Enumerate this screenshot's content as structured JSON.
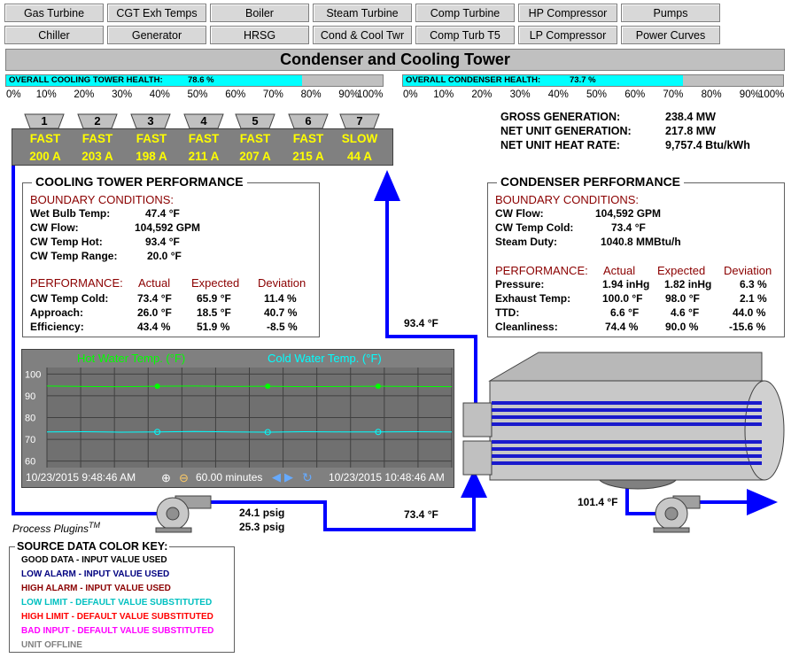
{
  "nav": {
    "row1": [
      "Gas Turbine",
      "CGT Exh Temps",
      "Boiler",
      "Steam Turbine",
      "Comp Turbine",
      "HP Compressor",
      "Pumps"
    ],
    "row2": [
      "Chiller",
      "Generator",
      "HRSG",
      "Cond & Cool Twr",
      "Comp Turb T5",
      "LP Compressor",
      "Power Curves"
    ]
  },
  "title": "Condenser and Cooling Tower",
  "health": {
    "cooling_label": "OVERALL COOLING TOWER HEALTH:",
    "cooling_value": "78.6 %",
    "cooling_fraction": 0.786,
    "condenser_label": "OVERALL CONDENSER HEALTH:",
    "condenser_value": "73.7 %",
    "condenser_fraction": 0.737,
    "ticks": [
      "0%",
      "10%",
      "20%",
      "30%",
      "40%",
      "50%",
      "60%",
      "70%",
      "80%",
      "90%",
      "100%"
    ]
  },
  "fans": [
    {
      "num": "1",
      "status": "FAST",
      "amps": "200 A"
    },
    {
      "num": "2",
      "status": "FAST",
      "amps": "203 A"
    },
    {
      "num": "3",
      "status": "FAST",
      "amps": "198 A"
    },
    {
      "num": "4",
      "status": "FAST",
      "amps": "211 A"
    },
    {
      "num": "5",
      "status": "FAST",
      "amps": "207 A"
    },
    {
      "num": "6",
      "status": "FAST",
      "amps": "215 A"
    },
    {
      "num": "7",
      "status": "SLOW",
      "amps": "44 A"
    }
  ],
  "generation": {
    "gross_label": "GROSS GENERATION:",
    "gross_value": "238.4 MW",
    "net_label": "NET UNIT GENERATION:",
    "net_value": "217.8 MW",
    "heat_label": "NET UNIT HEAT RATE:",
    "heat_value": "9,757.4 Btu/kWh"
  },
  "cooling_tower": {
    "title": "COOLING TOWER PERFORMANCE",
    "boundary_title": "BOUNDARY CONDITIONS:",
    "boundary": [
      {
        "label": "Wet Bulb Temp:",
        "value": "47.4 °F"
      },
      {
        "label": "CW Flow:",
        "value": "104,592 GPM"
      },
      {
        "label": "CW Temp Hot:",
        "value": "93.4 °F"
      },
      {
        "label": "CW Temp Range:",
        "value": "20.0 °F"
      }
    ],
    "perf_title": "PERFORMANCE:",
    "headers": [
      "Actual",
      "Expected",
      "Deviation"
    ],
    "perf": [
      {
        "label": "CW Temp Cold:",
        "actual": "73.4 °F",
        "expected": "65.9 °F",
        "deviation": "11.4 %"
      },
      {
        "label": "Approach:",
        "actual": "26.0 °F",
        "expected": "18.5 °F",
        "deviation": "40.7 %"
      },
      {
        "label": "Efficiency:",
        "actual": "43.4 %",
        "expected": "51.9 %",
        "deviation": "-8.5 %"
      }
    ]
  },
  "condenser": {
    "title": "CONDENSER PERFORMANCE",
    "boundary_title": "BOUNDARY CONDITIONS:",
    "boundary": [
      {
        "label": "CW Flow:",
        "value": "104,592 GPM"
      },
      {
        "label": "CW Temp Cold:",
        "value": "73.4 °F"
      },
      {
        "label": "Steam Duty:",
        "value": "1040.8 MMBtu/h"
      }
    ],
    "perf_title": "PERFORMANCE:",
    "headers": [
      "Actual",
      "Expected",
      "Deviation"
    ],
    "perf": [
      {
        "label": "Pressure:",
        "actual": "1.94 inHg",
        "expected": "1.82 inHg",
        "deviation": "6.3 %"
      },
      {
        "label": "Exhaust Temp:",
        "actual": "100.0 °F",
        "expected": "98.0 °F",
        "deviation": "2.1 %"
      },
      {
        "label": "TTD:",
        "actual": "6.6 °F",
        "expected": "4.6 °F",
        "deviation": "44.0 %"
      },
      {
        "label": "Cleanliness:",
        "actual": "74.4 %",
        "expected": "90.0 %",
        "deviation": "-15.6 %"
      }
    ]
  },
  "trend": {
    "series1": "Hot Water Temp. (°F)",
    "series2": "Cold Water Temp. (°F)",
    "series1_color": "#00ff00",
    "series2_color": "#00ffff",
    "yticks": [
      "100",
      "90",
      "80",
      "70",
      "60"
    ],
    "start": "10/23/2015 9:48:46 AM",
    "end": "10/23/2015 10:48:46 AM",
    "span": "60.00 minutes"
  },
  "chart_data": {
    "type": "line",
    "ylim": [
      57,
      103
    ],
    "series": [
      {
        "name": "Hot Water Temp. (°F)",
        "values": [
          94.5,
          94.3,
          94.2,
          94.4,
          94.5,
          94.3,
          94.4,
          94.2,
          94.3,
          94.4,
          94.3,
          94.2
        ]
      },
      {
        "name": "Cold Water Temp. (°F)",
        "values": [
          73.4,
          73.5,
          73.3,
          73.4,
          73.6,
          73.4,
          73.3,
          73.5,
          73.4,
          73.4,
          73.5,
          73.4
        ]
      }
    ]
  },
  "flow": {
    "hot_temp": "93.4 °F",
    "cold_temp": "73.4 °F",
    "exhaust_temp": "101.4 °F",
    "psig1": "24.1 psig",
    "psig2": "25.3 psig",
    "brand": "Process Plugins",
    "brand_tm": "TM"
  },
  "key": {
    "title": "SOURCE DATA COLOR KEY:",
    "items": [
      {
        "text": "GOOD DATA - INPUT VALUE USED",
        "color": "#000000"
      },
      {
        "text": "LOW ALARM - INPUT VALUE USED",
        "color": "#000080"
      },
      {
        "text": "HIGH ALARM - INPUT VALUE USED",
        "color": "#8b0000"
      },
      {
        "text": "LOW LIMIT - DEFAULT VALUE SUBSTITUTED",
        "color": "#00c0c0"
      },
      {
        "text": "HIGH LIMIT - DEFAULT VALUE SUBSTITUTED",
        "color": "#ff0000"
      },
      {
        "text": "BAD INPUT - DEFAULT VALUE SUBSTITUTED",
        "color": "#ff00ff"
      },
      {
        "text": "UNIT OFFLINE",
        "color": "#808080"
      }
    ]
  }
}
